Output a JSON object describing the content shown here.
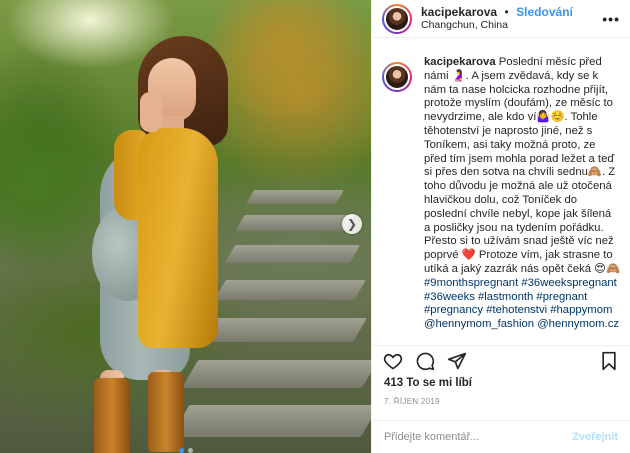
{
  "post": {
    "username": "kacipekarova",
    "separator": "•",
    "follow_label": "Sledování",
    "location": "Changchun, China",
    "more_label": "•••"
  },
  "caption": {
    "username": "kacipekarova",
    "text": "Poslední měsíc před námi 🤰. A jsem zvědavá, kdy se k nám ta nase holcicka rozhodne přijít, protože myslím (doufám), ze měsíc to nevydrzime, ale kdo ví🤷‍♀️☺️. Tohle těhotenství je naprosto jiné, než s Toníkem, asi taky možná proto, ze před tím jsem mohla porad ležet a teď si přes den sotva na chvíli sednu🙈. Z toho důvodu je možná ale už otočená hlavičkou dolu, což Toníček do poslední chvíle nebyl, kope jak šílená a posličky jsou na tydením pořádku. Přesto si to užívám snad ještě víc než poprvé ❤️ Protoze vím, jak strasne to utíká a jaký zazrák nás opět čeká 😍🙈",
    "hashtags": "#9monthspregnant #36weekspregnant #36weeks #lastmonth #pregnant #pregnancy #tehotenstvi #happymom @hennymom_fashion @hennymom.cz"
  },
  "actions": {
    "like_icon": "heart-icon",
    "comment_icon": "comment-icon",
    "share_icon": "share-icon",
    "save_icon": "bookmark-icon"
  },
  "likes_text": "413 To se mi líbí",
  "date_text": "7. ŘÍJEN 2019",
  "comment": {
    "placeholder": "Přidejte komentář...",
    "post_label": "Zveřejnit"
  },
  "carousel": {
    "next_icon": "chevron-right-icon",
    "dots": 2,
    "active_dot": 1
  },
  "colors": {
    "link_blue": "#3897f0",
    "cardigan_mustard": "#e3aa2a",
    "disabled_blue": "#b2dffc"
  }
}
